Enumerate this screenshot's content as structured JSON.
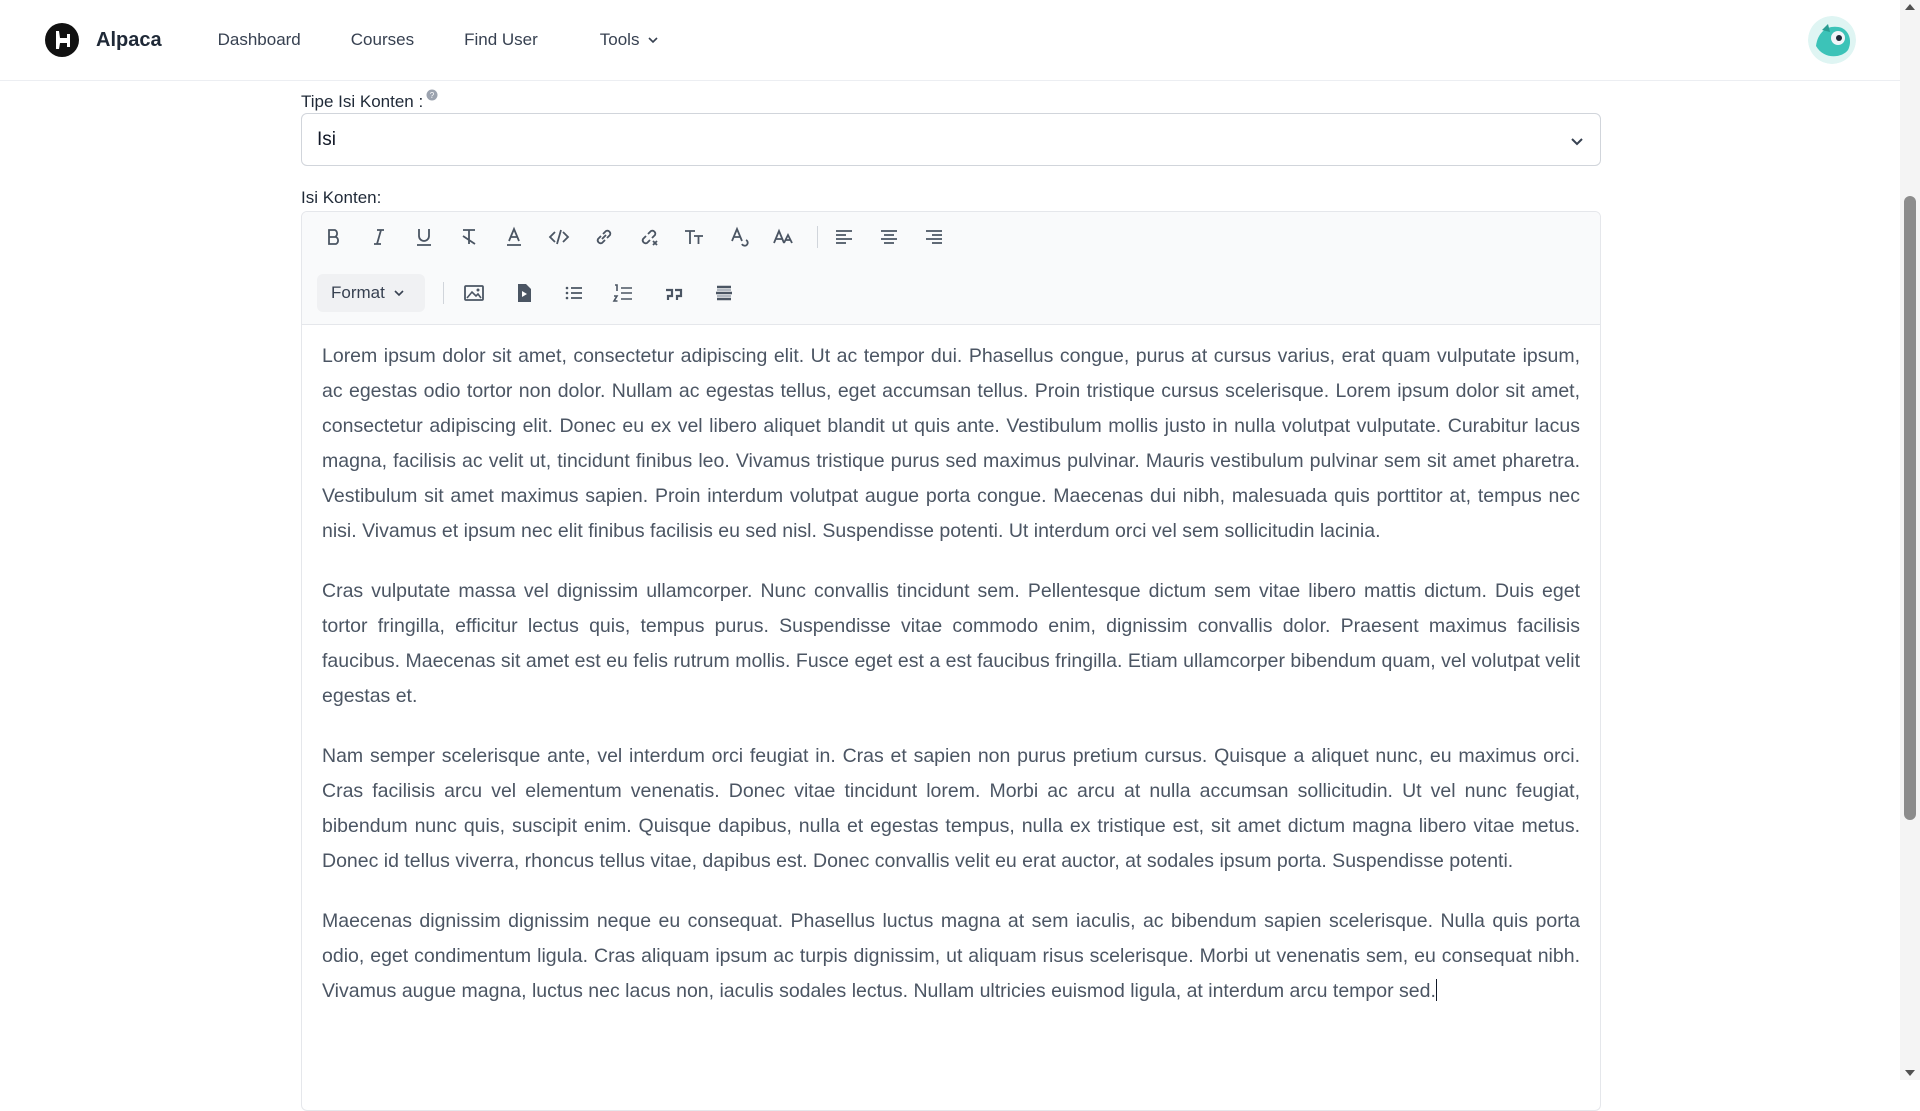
{
  "nav": {
    "brand": "Alpaca",
    "links": [
      "Dashboard",
      "Courses",
      "Find User"
    ],
    "tools_label": "Tools"
  },
  "form": {
    "type_label": "Tipe Isi Konten :",
    "type_value": "Isi",
    "content_label": "Isi Konten:"
  },
  "toolbar": {
    "row1": [
      "bold-icon",
      "italic-icon",
      "underline-icon",
      "clear-format-icon",
      "text-color-icon",
      "code-icon",
      "link-icon",
      "unlink-icon",
      "text-size-icon",
      "font-color-icon",
      "font-size-icon",
      "align-left-icon",
      "align-center-icon",
      "align-right-icon"
    ],
    "format_label": "Format",
    "row2": [
      "image-icon",
      "video-icon",
      "bullet-list-icon",
      "numbered-list-icon",
      "quote-icon",
      "horizontal-rule-icon"
    ]
  },
  "editor": {
    "paragraphs": [
      "Lorem ipsum dolor sit amet, consectetur adipiscing elit. Ut ac tempor dui. Phasellus congue, purus at cursus varius, erat quam vulputate ipsum, ac egestas odio tortor non dolor. Nullam ac egestas tellus, eget accumsan tellus. Proin tristique cursus scelerisque. Lorem ipsum dolor sit amet, consectetur adipiscing elit. Donec eu ex vel libero aliquet blandit ut quis ante. Vestibulum mollis justo in nulla volutpat vulputate. Curabitur lacus magna, facilisis ac velit ut, tincidunt finibus leo. Vivamus tristique purus sed maximus pulvinar. Mauris vestibulum pulvinar sem sit amet pharetra. Vestibulum sit amet maximus sapien. Proin interdum volutpat augue porta congue. Maecenas dui nibh, malesuada quis porttitor at, tempus nec nisi. Vivamus et ipsum nec elit finibus facilisis eu sed nisl. Suspendisse potenti. Ut interdum orci vel sem sollicitudin lacinia.",
      "Cras vulputate massa vel dignissim ullamcorper. Nunc convallis tincidunt sem. Pellentesque dictum sem vitae libero mattis dictum. Duis eget tortor fringilla, efficitur lectus quis, tempus purus. Suspendisse vitae commodo enim, dignissim convallis dolor. Praesent maximus facilisis faucibus. Maecenas sit amet est eu felis rutrum mollis. Fusce eget est a est faucibus fringilla. Etiam ullamcorper bibendum quam, vel volutpat velit egestas et.",
      "Nam semper scelerisque ante, vel interdum orci feugiat in. Cras et sapien non purus pretium cursus. Quisque a aliquet nunc, eu maximus orci. Cras facilisis arcu vel elementum venenatis. Donec vitae tincidunt lorem. Morbi ac arcu at nulla accumsan sollicitudin. Ut vel nunc feugiat, bibendum nunc quis, suscipit enim. Quisque dapibus, nulla et egestas tempus, nulla ex tristique est, sit amet dictum magna libero vitae metus. Donec id tellus viverra, rhoncus tellus vitae, dapibus est. Donec convallis velit eu erat auctor, at sodales ipsum porta. Suspendisse potenti.",
      "Maecenas dignissim dignissim neque eu consequat. Phasellus luctus magna at sem iaculis, ac bibendum sapien scelerisque. Nulla quis porta odio, eget condimentum ligula. Cras aliquam ipsum ac turpis dignissim, ut aliquam risus scelerisque. Morbi ut venenatis sem, eu consequat nibh. Vivamus augue magna, luctus nec lacus non, iaculis sodales lectus. Nullam ultricies euismod ligula, at interdum arcu tempor sed."
    ]
  },
  "colors": {
    "text": "#4b5563",
    "border": "#d1d5db",
    "toolbar_bg": "#f9fafb"
  }
}
